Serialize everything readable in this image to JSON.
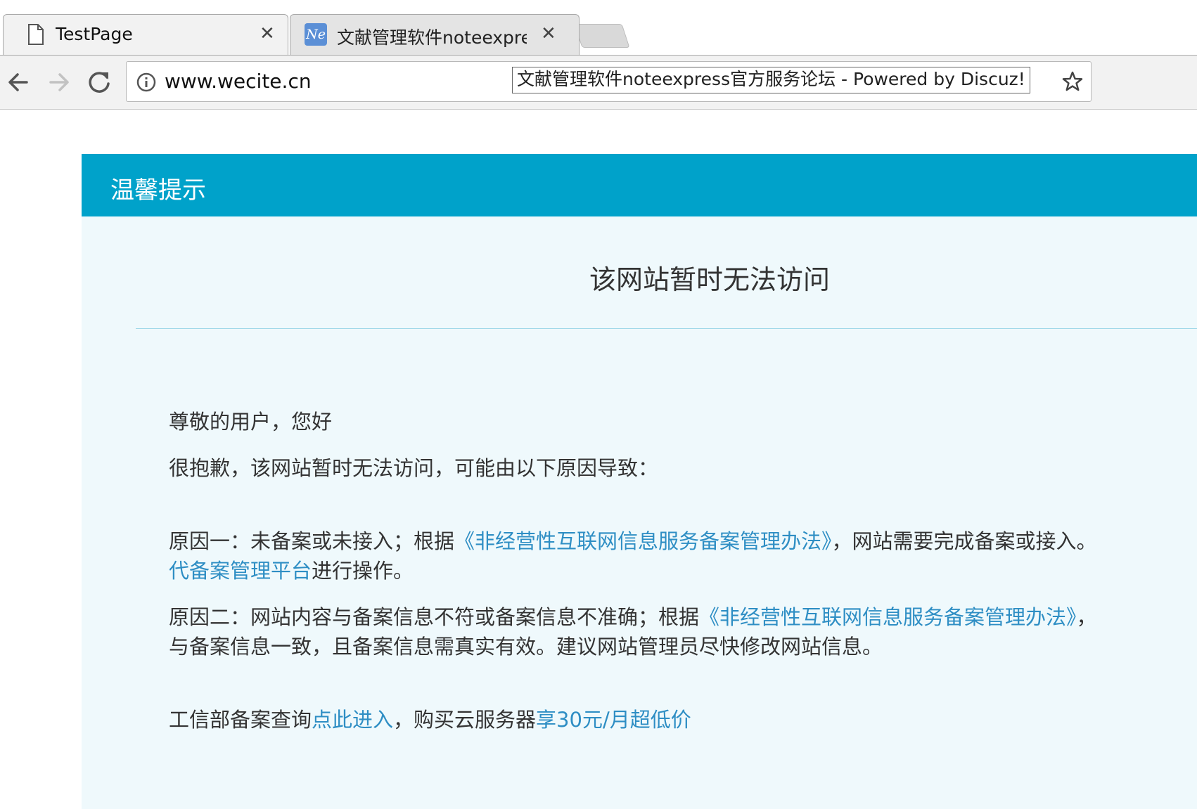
{
  "browser": {
    "tabs": [
      {
        "title": "TestPage",
        "icon": "document-icon",
        "active": true
      },
      {
        "title": "文献管理软件noteexpre",
        "icon": "noteexpress-favicon",
        "active": false
      }
    ],
    "favicon_text": "Ne",
    "address": "www.wecite.cn",
    "tooltip": "文献管理软件noteexpress官方服务论坛 - Powered by Discuz!"
  },
  "notice": {
    "header_title": "温馨提示",
    "heading": "该网站暂时无法访问",
    "greeting": "尊敬的用户，您好",
    "intro": "很抱歉，该网站暂时无法访问，可能由以下原因导致：",
    "reason1": {
      "prefix": "原因一：未备案或未接入；根据",
      "link": "《非经营性互联网信息服务备案管理办法》",
      "suffix": "，网站需要完成备案或接入。",
      "line2_link": "代备案管理平台",
      "line2_suffix": "进行操作。"
    },
    "reason2": {
      "prefix": "原因二：网站内容与备案信息不符或备案信息不准确；根据",
      "link": "《非经营性互联网信息服务备案管理办法》",
      "suffix": "，",
      "line2": "与备案信息一致，且备案信息需真实有效。建议网站管理员尽快修改网站信息。"
    },
    "footer": {
      "prefix": "工信部备案查询",
      "link1": "点此进入",
      "middle": "，购买云服务器",
      "link2": "享30元/月超低价"
    }
  },
  "colors": {
    "header_bg": "#00a2ca",
    "panel_bg": "#eff9fc",
    "link": "#2e8ec4"
  }
}
